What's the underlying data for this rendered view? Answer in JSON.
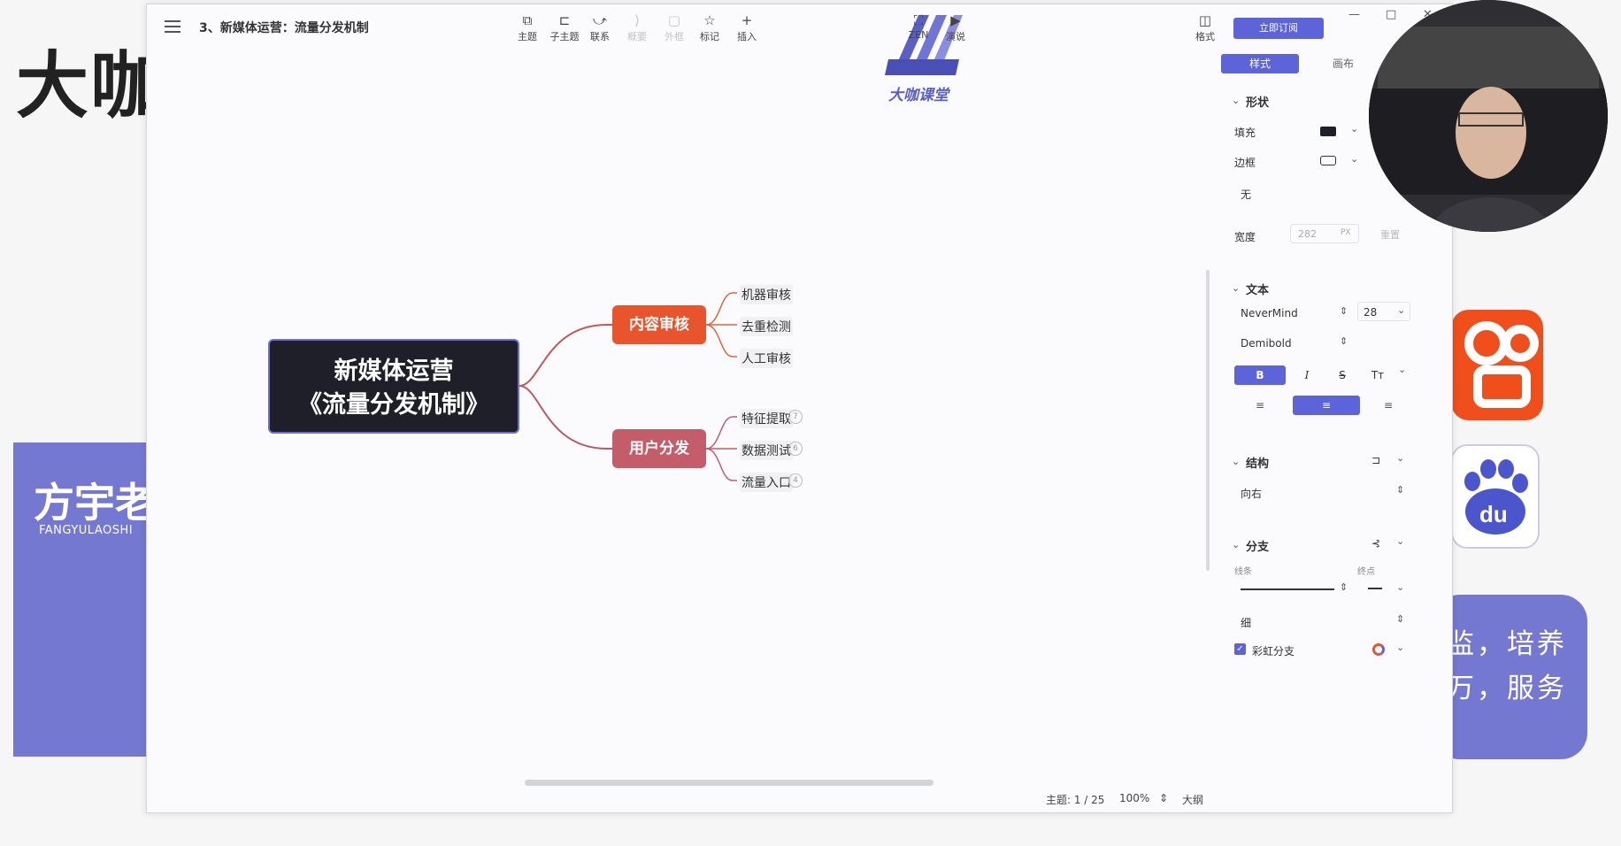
{
  "background": {
    "title": "大咖",
    "presenter_name": "方宇老",
    "presenter_pinyin": "FANGYULAOSHI",
    "right_text_line1": "监，培养",
    "right_text_line2": "万，服务",
    "baidu_glyph": "du"
  },
  "window": {
    "doc_title": "3、新媒体运营：流量分发机制",
    "toolbar": [
      {
        "label": "主题",
        "icon": "topic-icon",
        "glyph": "⧉",
        "enabled": true
      },
      {
        "label": "子主题",
        "icon": "subtopic-icon",
        "glyph": "⊏",
        "enabled": true
      },
      {
        "label": "联系",
        "icon": "relation-icon",
        "glyph": "⤻",
        "enabled": true
      },
      {
        "label": "概要",
        "icon": "summary-icon",
        "glyph": "⟩",
        "enabled": false
      },
      {
        "label": "外框",
        "icon": "boundary-icon",
        "glyph": "▢",
        "enabled": false
      },
      {
        "label": "标记",
        "icon": "marker-icon",
        "glyph": "☆",
        "enabled": true
      },
      {
        "label": "插入",
        "icon": "insert-icon",
        "glyph": "+",
        "enabled": true
      }
    ],
    "right_tools": [
      {
        "label": "ZEN",
        "icon": "zen-icon",
        "glyph": "⛶"
      },
      {
        "label": "演说",
        "icon": "pitch-icon",
        "glyph": "▶"
      },
      {
        "label": "格式",
        "icon": "format-panel-icon",
        "glyph": "◫"
      }
    ],
    "logo_text": "大咖课堂",
    "subscribe_label": "立即订阅",
    "window_controls": [
      "—",
      "□",
      "✕"
    ]
  },
  "mindmap": {
    "root_line1": "新媒体运营",
    "root_line2": "《流量分发机制》",
    "branches": [
      {
        "label": "内容审核",
        "color": "#e8552c",
        "leaves": [
          {
            "label": "机器审核"
          },
          {
            "label": "去重检测"
          },
          {
            "label": "人工审核"
          }
        ]
      },
      {
        "label": "用户分发",
        "color": "#c45d6a",
        "leaves": [
          {
            "label": "特征提取",
            "count": "7"
          },
          {
            "label": "数据测试",
            "count": "6"
          },
          {
            "label": "流量入口",
            "count": "4"
          }
        ]
      }
    ]
  },
  "statusbar": {
    "topic_count": "主题: 1 / 25",
    "zoom": "100%",
    "outline": "大纲"
  },
  "panel": {
    "tab_style": "样式",
    "tab_map": "画布",
    "shape_section": "形状",
    "fill_label": "填充",
    "border_label": "边框",
    "border_value": "无",
    "width_label": "宽度",
    "width_value": "282",
    "width_unit": "PX",
    "width_reset": "重置",
    "text_section": "文本",
    "font_family": "NeverMind",
    "font_size": "28",
    "font_weight": "Demibold",
    "bold": "B",
    "italic": "I",
    "strike": "S",
    "case": "Tт",
    "structure_section": "结构",
    "structure_value": "向右",
    "branch_section": "分支",
    "line_label": "线条",
    "end_label": "终点",
    "thickness_value": "细",
    "rainbow_label": "彩虹分支",
    "rainbow_checked": true,
    "fill_color": "#1f1f2a",
    "accent": "#5d63d8"
  }
}
